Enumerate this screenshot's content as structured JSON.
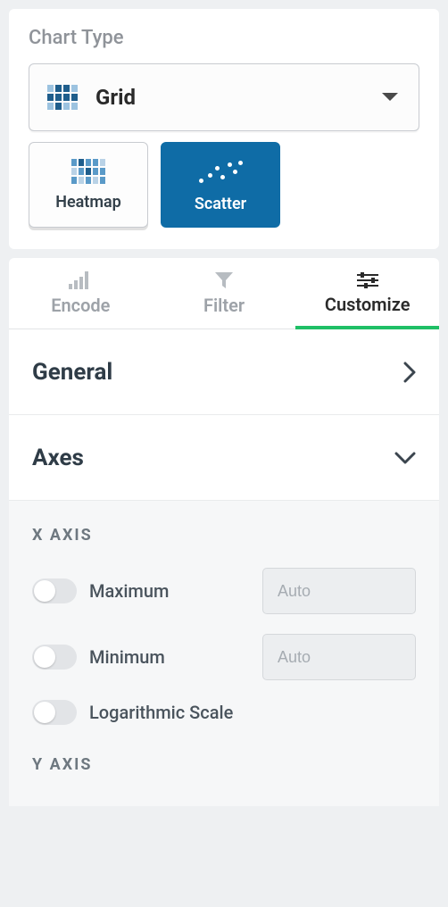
{
  "chartType": {
    "title": "Chart Type",
    "dropdown": {
      "label": "Grid"
    },
    "subtypes": [
      {
        "label": "Heatmap",
        "selected": false
      },
      {
        "label": "Scatter",
        "selected": true
      }
    ]
  },
  "tabs": [
    {
      "label": "Encode",
      "active": false
    },
    {
      "label": "Filter",
      "active": false
    },
    {
      "label": "Customize",
      "active": true
    }
  ],
  "accordion": {
    "general": {
      "label": "General",
      "expanded": false
    },
    "axes": {
      "label": "Axes",
      "expanded": true,
      "x": {
        "title": "X AXIS",
        "max": {
          "label": "Maximum",
          "placeholder": "Auto",
          "value": "",
          "on": false
        },
        "min": {
          "label": "Minimum",
          "placeholder": "Auto",
          "value": "",
          "on": false
        },
        "log": {
          "label": "Logarithmic Scale",
          "on": false
        }
      },
      "y": {
        "title": "Y AXIS"
      }
    }
  }
}
